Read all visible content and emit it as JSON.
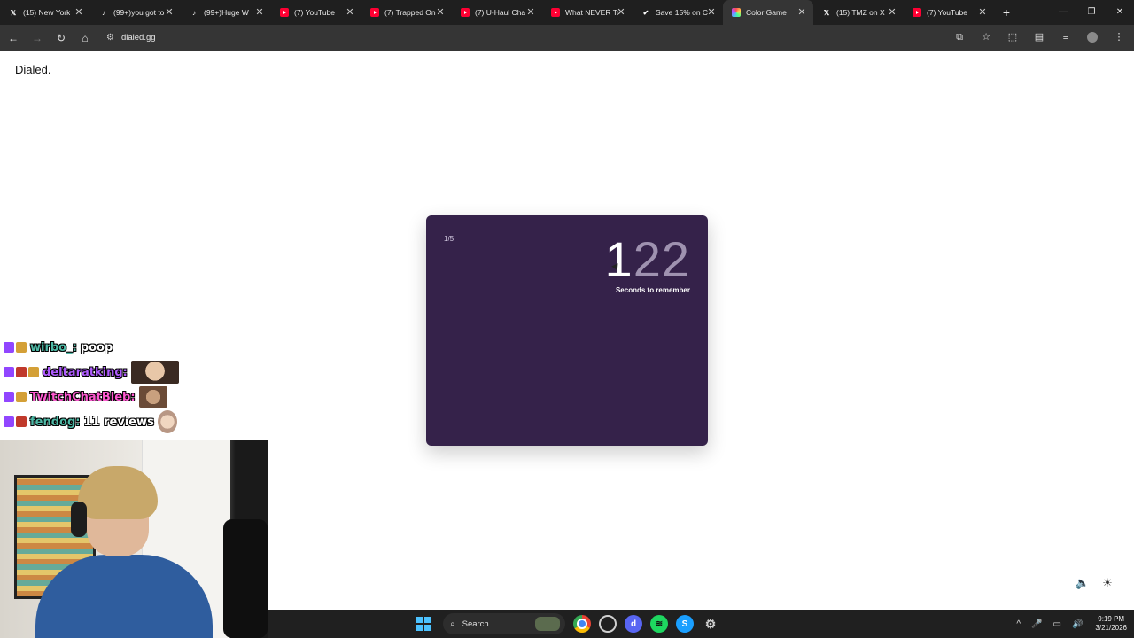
{
  "browser": {
    "tabs": [
      {
        "label": "(15) New York",
        "icon": "x-logo-icon",
        "active": false
      },
      {
        "label": "(99+)you got to",
        "icon": "tiktok-icon",
        "active": false
      },
      {
        "label": "(99+)Huge W",
        "icon": "tiktok-icon",
        "active": false
      },
      {
        "label": "(7) YouTube",
        "icon": "youtube-icon",
        "active": false
      },
      {
        "label": "(7) Trapped On",
        "icon": "youtube-icon",
        "active": false
      },
      {
        "label": "(7) U-Haul Cha",
        "icon": "youtube-icon",
        "active": false
      },
      {
        "label": "What NEVER To",
        "icon": "youtube-icon",
        "active": false
      },
      {
        "label": "Save 15% on C",
        "icon": "steam-icon",
        "active": false
      },
      {
        "label": "Color Game",
        "icon": "color-wheel-icon",
        "active": true
      },
      {
        "label": "(15) TMZ on X",
        "icon": "x-logo-icon",
        "active": false
      },
      {
        "label": "(7) YouTube",
        "icon": "youtube-icon",
        "active": false
      }
    ],
    "url": "dialed.gg"
  },
  "page": {
    "brand": "Dialed.",
    "game": {
      "progress": "1/5",
      "timer_lead": "1",
      "timer_rest": "22",
      "caption": "Seconds to remember",
      "card_color": "#35224a"
    }
  },
  "chat": [
    {
      "user": "wirbo_:",
      "user_color": "#4fb9a6",
      "message": "poop",
      "badges": [
        "twitch",
        "gold"
      ],
      "emote": null
    },
    {
      "user": "deltaratking:",
      "user_color": "#b05cff",
      "message": "",
      "badges": [
        "twitch",
        "sub",
        "gold"
      ],
      "emote": "face1"
    },
    {
      "user": "TwitchChatBleb:",
      "user_color": "#ff5ad2",
      "message": "",
      "badges": [
        "twitch",
        "gold"
      ],
      "emote": "face2"
    },
    {
      "user": "fendog:",
      "user_color": "#4fb9a6",
      "message": "11 reviews",
      "badges": [
        "twitch",
        "sub"
      ],
      "emote": "face3"
    }
  ],
  "taskbar": {
    "search_placeholder": "Search",
    "time": "9:19 PM",
    "date": "3/21/2026"
  }
}
